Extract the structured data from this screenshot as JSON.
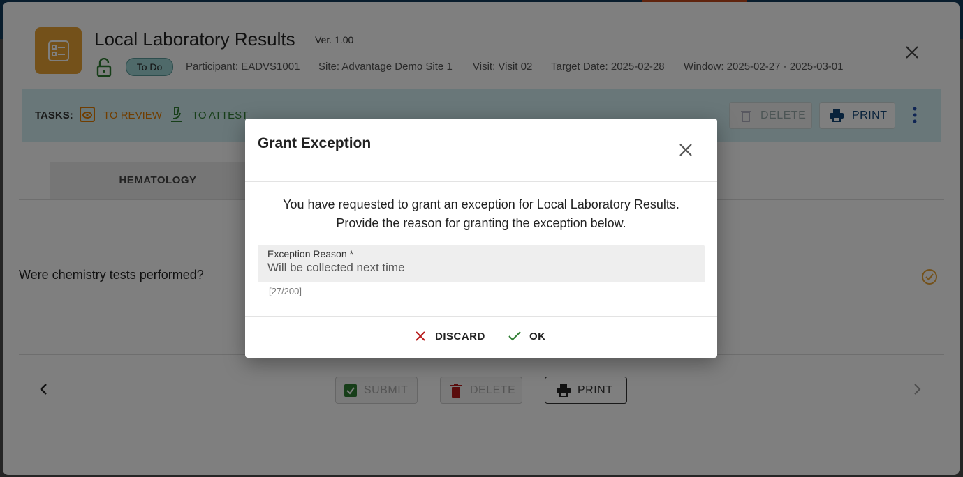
{
  "form": {
    "title": "Local Laboratory Results",
    "version": "Ver. 1.00",
    "status": "To Do",
    "participant": "Participant: EADVS1001",
    "site": "Site: Advantage Demo Site 1",
    "visit": "Visit: Visit 02",
    "target_date": "Target Date: 2025-02-28",
    "window": "Window: 2025-02-27 - 2025-03-01"
  },
  "tasks": {
    "label": "TASKS:",
    "to_review": "TO REVIEW",
    "to_attest": "TO ATTEST",
    "delete_label": "DELETE",
    "print_label": "PRINT"
  },
  "tabs": [
    {
      "label": "HEMATOLOGY"
    }
  ],
  "question": {
    "text": "Were chemistry tests performed?"
  },
  "footer": {
    "submit_label": "SUBMIT",
    "delete_label": "DELETE",
    "print_label": "PRINT"
  },
  "modal": {
    "title": "Grant Exception",
    "message_line1": "You have requested to grant an exception for Local Laboratory Results.",
    "message_line2": "Provide the reason for granting the exception below.",
    "field_label": "Exception Reason *",
    "field_value": "Will be collected next time",
    "counter": "[27/200]",
    "discard_label": "DISCARD",
    "ok_label": "OK"
  },
  "colors": {
    "form_icon_bg": "#e8a335",
    "tasks_bar_bg": "#d2eef2",
    "review_color": "#e07a00",
    "attest_color": "#2e7d32",
    "discard_color": "#b71c1c",
    "ok_color": "#2e7d32"
  }
}
